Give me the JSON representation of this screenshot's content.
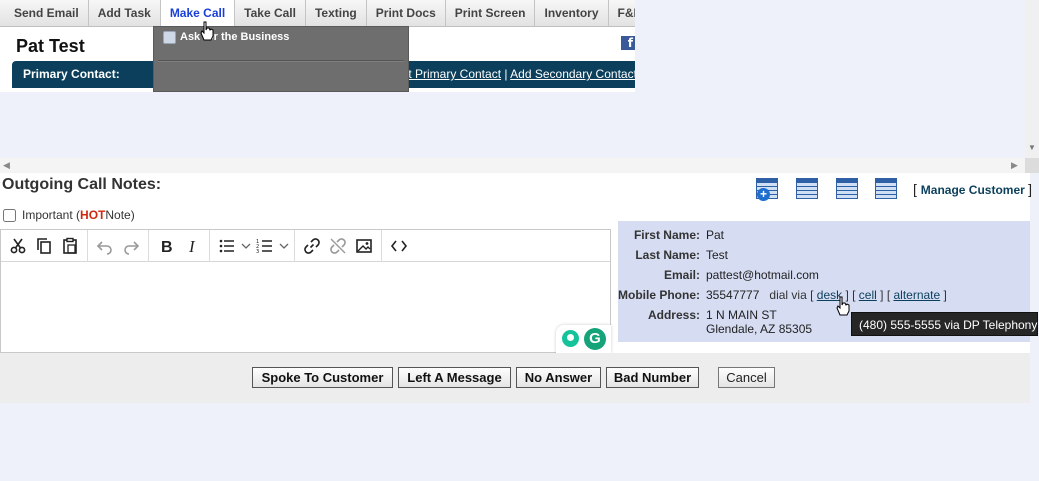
{
  "tabs": [
    {
      "label": "Send Email"
    },
    {
      "label": "Add Task"
    },
    {
      "label": "Make Call"
    },
    {
      "label": "Take Call"
    },
    {
      "label": "Texting"
    },
    {
      "label": "Print Docs"
    },
    {
      "label": "Print Screen"
    },
    {
      "label": "Inventory"
    },
    {
      "label": "F&I Form"
    }
  ],
  "active_tab": "Make Call",
  "customer_name": "Pat Test",
  "primary_contact": {
    "label": "Primary Contact:",
    "edit_link": "lit Primary Contact",
    "add_secondary_link": "Add Secondary Contact"
  },
  "dropdown": {
    "item1": "Ask for the Business"
  },
  "notes": {
    "title": "Outgoing Call Notes:",
    "important_label": "Important (",
    "hot_label": "HOT",
    "note_label": " Note)",
    "manage_customer": "Manage Customer"
  },
  "toolbar_icons": [
    "cut-icon",
    "copy-icon",
    "paste-icon",
    "undo-icon",
    "redo-icon",
    "bold-icon",
    "italic-icon",
    "bullet-list-icon",
    "numbered-list-icon",
    "link-icon",
    "unlink-icon",
    "image-icon",
    "code-icon"
  ],
  "customer_info": {
    "first_name_label": "First Name:",
    "first_name": "Pat",
    "last_name_label": "Last Name:",
    "last_name": "Test",
    "email_label": "Email:",
    "email": "pattest@hotmail.com",
    "mobile_label": "Mobile Phone:",
    "mobile": "35547777",
    "dial_via": "dial via",
    "dial_desk": "desk",
    "dial_cell": "cell",
    "dial_alternate": "alternate",
    "address_label": "Address:",
    "address_line1": "1 N MAIN ST",
    "address_line2": "Glendale, AZ 85305"
  },
  "tooltip": "(480) 555-5555 via DP Telephony",
  "buttons": {
    "spoke": "Spoke To Customer",
    "left_message": "Left A Message",
    "no_answer": "No Answer",
    "bad_number": "Bad Number",
    "cancel": "Cancel"
  },
  "colors": {
    "header_bar": "#0b3f5b",
    "active_tab_text": "#1a3fd8",
    "hot": "#d0280e",
    "info_panel": "#d6ddf3",
    "page_bg": "#eef0fa"
  }
}
